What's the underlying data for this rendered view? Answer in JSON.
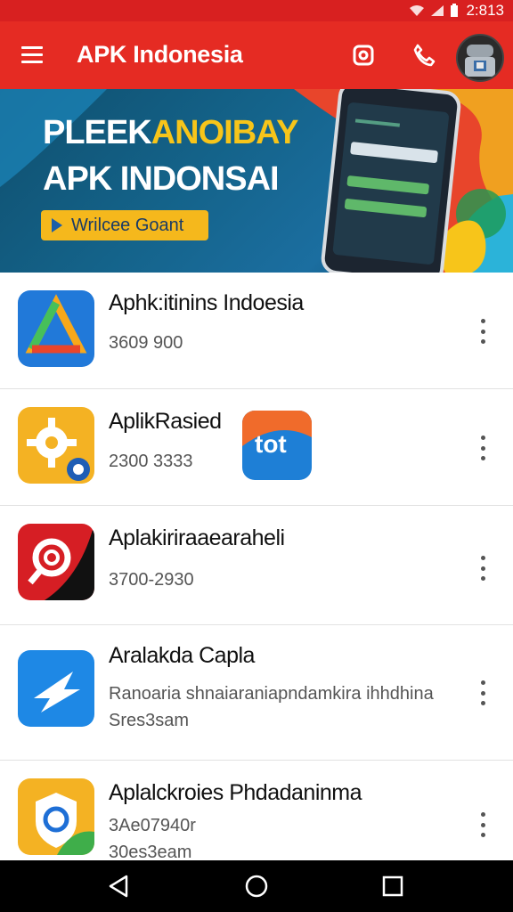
{
  "status": {
    "time": "2:813"
  },
  "app_bar": {
    "title": "APK Indonesia",
    "icons": [
      "menu-icon",
      "camera-icon",
      "phone-icon",
      "avatar"
    ]
  },
  "banner": {
    "line1_white": "PLEEK",
    "line1_yellow": "ANOIBAY",
    "line2": "APK INDONSAI",
    "button_label": "Wrilcee Goant"
  },
  "apps": [
    {
      "title": "Aphk:itinins Indoesia",
      "sub": "3609 900",
      "sub2": "",
      "icon": "triangle-app-icon",
      "color": "#2179d9"
    },
    {
      "title": "AplikRasied",
      "sub": "2300 3333",
      "sub2": "",
      "icon": "gear-app-icon",
      "color": "#f4b223",
      "extra_icon": "tot-app-icon",
      "extra_text": "tot"
    },
    {
      "title": "Aplakiriraaearaheli",
      "sub": "3700-2930",
      "sub2": "",
      "icon": "search-app-icon",
      "color": "#d61e24"
    },
    {
      "title": "Aralakda Capla",
      "sub": "Ranoaria shnaiaraniapndamkira ihhdhina",
      "sub2": "Sres3sam",
      "icon": "arrow-app-icon",
      "color": "#1e88e5"
    },
    {
      "title": "Aplalckroies Phdadaninma",
      "sub": "3Ae07940r",
      "sub2": "30es3eam",
      "icon": "shield-app-icon",
      "color": "#f4b223"
    }
  ],
  "colors": {
    "primary": "#e52b23",
    "status": "#d82020",
    "accent": "#f5b81c"
  }
}
